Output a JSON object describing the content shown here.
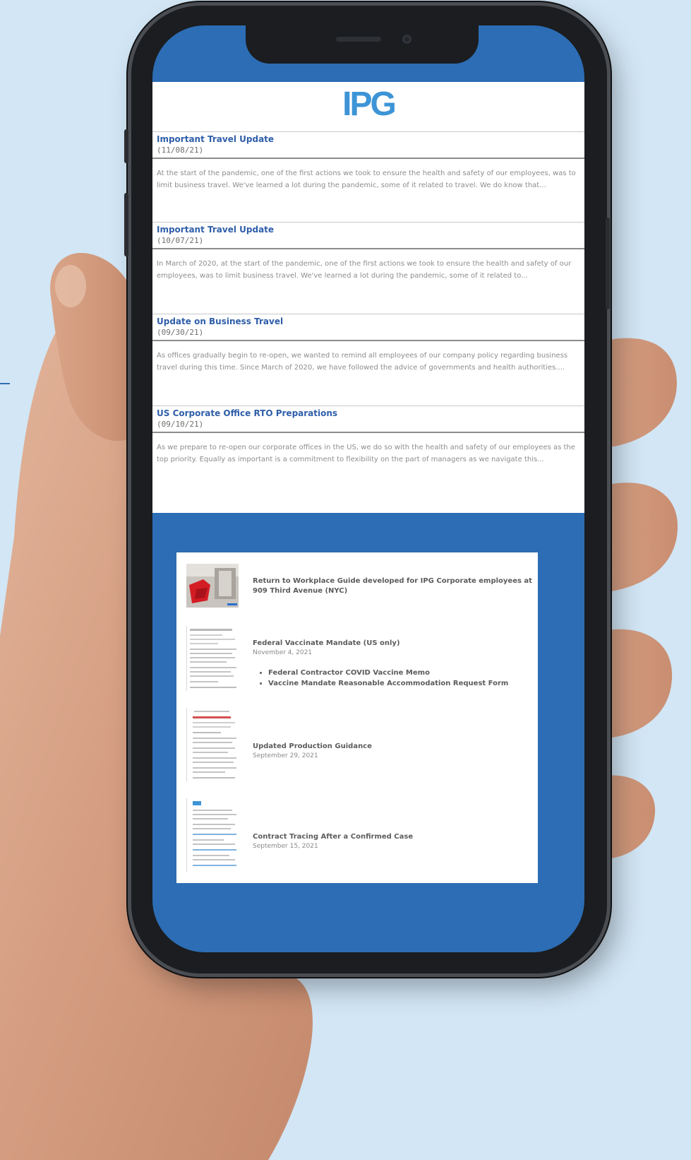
{
  "app": {
    "logo_text": "IPG",
    "brand_color": "#3d94d6",
    "header_color": "#2c6db5"
  },
  "news": [
    {
      "title": "Important Travel Update",
      "date": "(11/08/21)",
      "excerpt": "At the start of the pandemic, one of the first actions we took to ensure the health and safety of our employees, was to limit business travel. We've learned a lot during the pandemic, some of it related to travel. We do know that..."
    },
    {
      "title": "Important Travel Update",
      "date": "(10/07/21)",
      "excerpt": "In March of 2020, at the start of the pandemic, one of the first actions we took to ensure the health and safety of our employees, was to limit business travel. We've learned a lot during the pandemic, some of it related to..."
    },
    {
      "title": "Update on Business Travel",
      "date": "(09/30/21)",
      "excerpt": "As offices gradually begin to re-open, we wanted to remind all employees of our company policy regarding business travel during this time.  Since March of 2020, we have followed the advice of governments and health authorities...."
    },
    {
      "title": "US Corporate Office RTO Preparations",
      "date": "(09/10/21)",
      "excerpt": "As we prepare to re-open our corporate offices in the US, we do so with the health and safety of our employees as the top priority. Equally as important is a commitment to flexibility on the part of managers as we navigate this..."
    }
  ],
  "documents": [
    {
      "title": "Return to Workplace Guide developed for IPG Corporate employees at 909 Third Avenue (NYC)",
      "date": "",
      "links": []
    },
    {
      "title": "Federal Vaccinate Mandate (US only)",
      "date": "November 4, 2021",
      "links": [
        "Federal Contractor COVID Vaccine Memo",
        "Vaccine Mandate Reasonable Accommodation Request Form"
      ]
    },
    {
      "title": "Updated Production Guidance",
      "date": "September 29, 2021",
      "links": []
    },
    {
      "title": "Contract Tracing After a Confirmed Case",
      "date": "September 15, 2021",
      "links": []
    }
  ]
}
